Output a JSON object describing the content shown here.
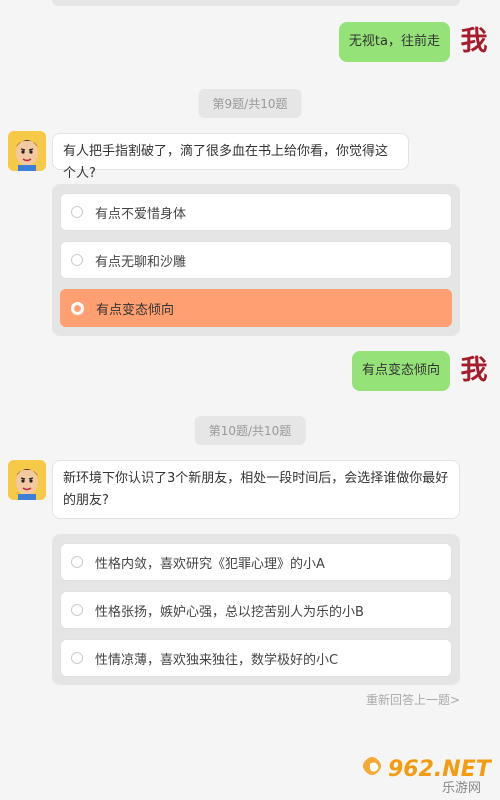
{
  "chat": {
    "prev_answer": "无视ta，往前走",
    "user_avatar_text": "我",
    "question9": {
      "number_label": "第9题/共10题",
      "text": "有人把手指割破了，滴了很多血在书上给你看，你觉得这个人?",
      "options": [
        {
          "label": "有点不爱惜身体",
          "selected": false
        },
        {
          "label": "有点无聊和沙雕",
          "selected": false
        },
        {
          "label": "有点变态倾向",
          "selected": true
        }
      ],
      "answer": "有点变态倾向"
    },
    "question10": {
      "number_label": "第10题/共10题",
      "text": "新环境下你认识了3个新朋友，相处一段时间后，会选择谁做你最好的朋友?",
      "options": [
        {
          "label": "性格内敛，喜欢研究《犯罪心理》的小A",
          "selected": false
        },
        {
          "label": "性格张扬，嫉妒心强，总以挖苦别人为乐的小B",
          "selected": false
        },
        {
          "label": "性情凉薄，喜欢独来独往，数学极好的小C",
          "selected": false
        }
      ]
    },
    "redo_label": "重新回答上一题>"
  },
  "watermark": {
    "brand": "962.NET",
    "sub": "乐游网"
  },
  "colors": {
    "user_bubble": "#95e279",
    "selected_option": "#ff9f72",
    "user_avatar_text": "#a51d2d",
    "bot_avatar_bg": "#f7c948"
  },
  "icons": {
    "bot_avatar": "cartoon-boy-avatar",
    "user_avatar": "wo-character-avatar",
    "radio": "radio-circle-icon"
  }
}
